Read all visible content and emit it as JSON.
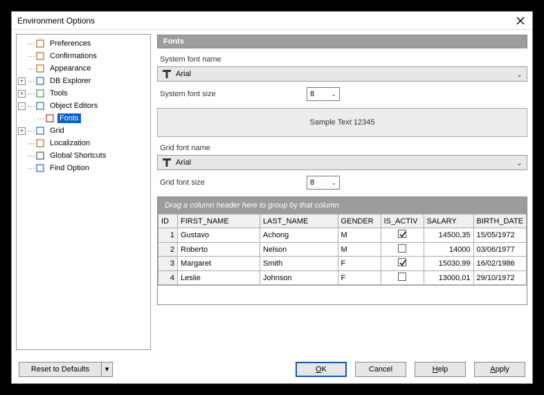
{
  "dialog": {
    "title": "Environment Options"
  },
  "tree": {
    "items": [
      {
        "label": "Preferences",
        "expander": "",
        "indent": 0
      },
      {
        "label": "Confirmations",
        "expander": "",
        "indent": 0
      },
      {
        "label": "Appearance",
        "expander": "",
        "indent": 0
      },
      {
        "label": "DB Explorer",
        "expander": "+",
        "indent": 0
      },
      {
        "label": "Tools",
        "expander": "+",
        "indent": 0
      },
      {
        "label": "Object Editors",
        "expander": "-",
        "indent": 0
      },
      {
        "label": "Fonts",
        "expander": "",
        "indent": 1,
        "selected": true
      },
      {
        "label": "Grid",
        "expander": "+",
        "indent": 0
      },
      {
        "label": "Localization",
        "expander": "",
        "indent": 0
      },
      {
        "label": "Global Shortcuts",
        "expander": "",
        "indent": 0
      },
      {
        "label": "Find Option",
        "expander": "",
        "indent": 0
      }
    ]
  },
  "fonts": {
    "header": "Fonts",
    "system_font_name_label": "System font name",
    "system_font_name": "Arial",
    "system_font_size_label": "System font size",
    "system_font_size": "8",
    "sample_text": "Sample Text 12345",
    "grid_font_name_label": "Grid font name",
    "grid_font_name": "Arial",
    "grid_font_size_label": "Grid font size",
    "grid_font_size": "8"
  },
  "grid": {
    "group_hint": "Drag a column header here to group by that column",
    "columns": [
      "ID",
      "FIRST_NAME",
      "LAST_NAME",
      "GENDER",
      "IS_ACTIVE",
      "SALARY",
      "BIRTH_DATE"
    ],
    "col_display": [
      "ID",
      "FIRST_NAME",
      "LAST_NAME",
      "GENDER",
      "IS_ACTIV",
      "SALARY",
      "BIRTH_DATE"
    ],
    "rows": [
      {
        "id": "1",
        "first": "Gustavo",
        "last": "Achong",
        "gender": "M",
        "active": true,
        "salary": "14500,35",
        "birth": "15/05/1972"
      },
      {
        "id": "2",
        "first": "Roberto",
        "last": "Nelson",
        "gender": "M",
        "active": false,
        "salary": "14000",
        "birth": "03/06/1977"
      },
      {
        "id": "3",
        "first": "Margaret",
        "last": "Smith",
        "gender": "F",
        "active": true,
        "salary": "15030,99",
        "birth": "16/02/1986"
      },
      {
        "id": "4",
        "first": "Leslie",
        "last": "Johnson",
        "gender": "F",
        "active": false,
        "salary": "13000,01",
        "birth": "29/10/1972"
      }
    ]
  },
  "buttons": {
    "reset": "Reset to Defaults",
    "ok": "OK",
    "cancel": "Cancel",
    "help": "Help",
    "apply": "Apply"
  }
}
